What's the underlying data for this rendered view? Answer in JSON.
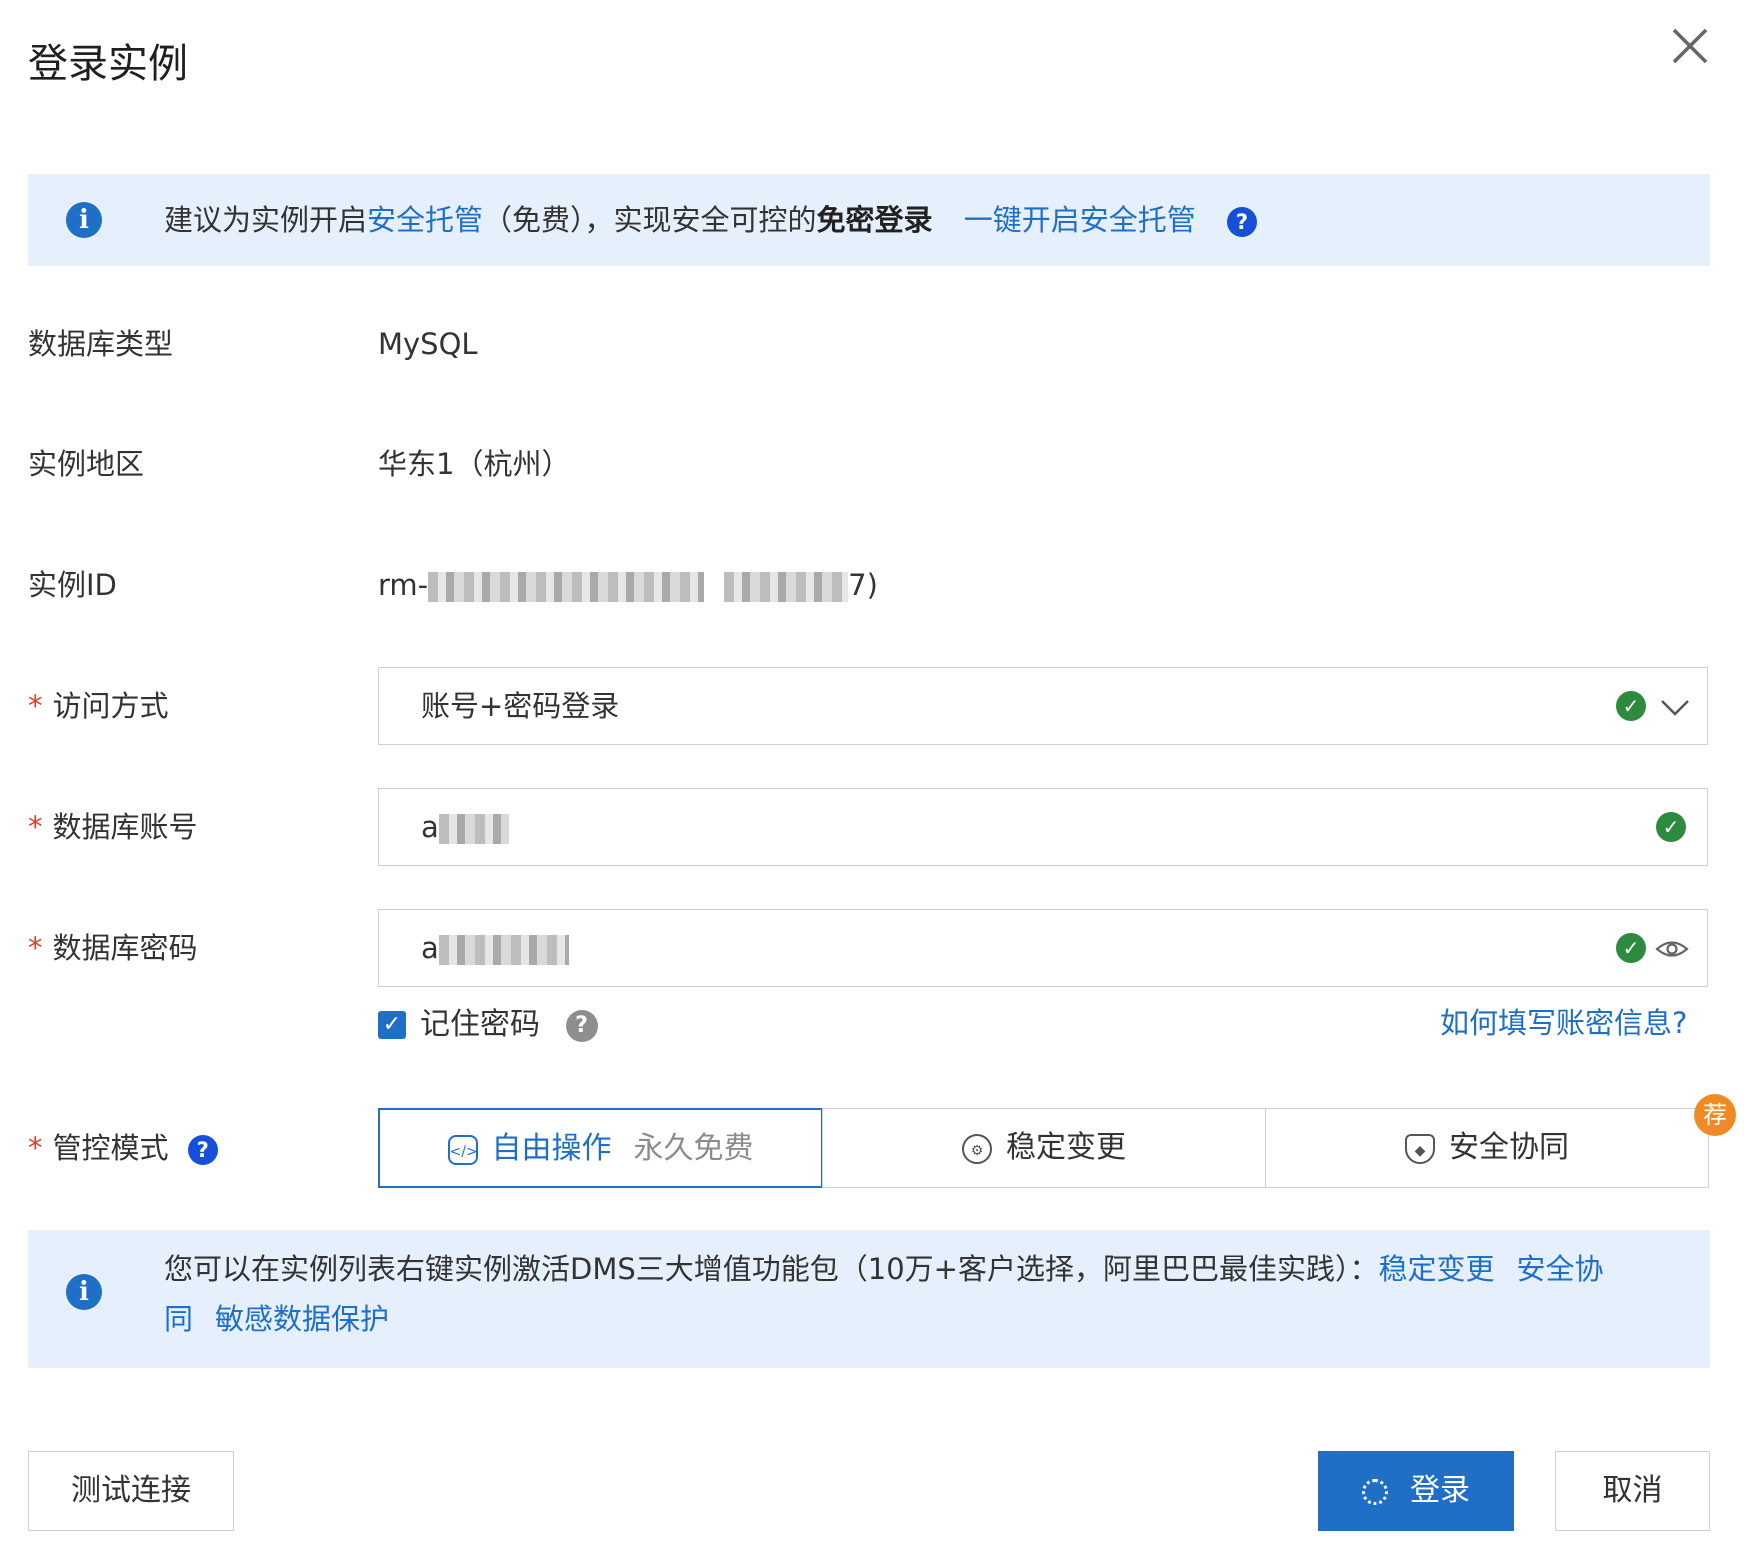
{
  "dialog": {
    "title": "登录实例",
    "close_icon": "close-icon"
  },
  "top_banner": {
    "text_1": "建议为实例开启",
    "link_1": "安全托管",
    "text_2": "（免费），实现安全可控的",
    "bold": "免密登录",
    "link_2": "一键开启安全托管",
    "help": "?"
  },
  "fields": {
    "db_type": {
      "label": "数据库类型",
      "value": "MySQL"
    },
    "region": {
      "label": "实例地区",
      "value": "华东1（杭州）"
    },
    "instance_id": {
      "label": "实例ID",
      "value_prefix": "rm-",
      "value_suffix": "7)"
    },
    "access_method": {
      "label": "访问方式",
      "value": "账号+密码登录"
    },
    "db_account": {
      "label": "数据库账号",
      "value_prefix": "a"
    },
    "db_password": {
      "label": "数据库密码",
      "value_prefix": "a"
    }
  },
  "remember_password": {
    "label": "记住密码",
    "checked": true,
    "help": "?"
  },
  "help_link": "如何填写账密信息?",
  "control_mode": {
    "label": "管控模式",
    "help": "?",
    "options": [
      {
        "label": "自由操作",
        "sub": "永久免费",
        "active": true,
        "icon": "code-icon"
      },
      {
        "label": "稳定变更",
        "active": false,
        "icon": "gear-icon"
      },
      {
        "label": "安全协同",
        "active": false,
        "icon": "shield-icon"
      }
    ],
    "badge": "荐"
  },
  "bottom_banner": {
    "text_1": "您可以在实例列表右键实例激活DMS三大增值功能包（10万+客户选择，阿里巴巴最佳实践）：",
    "link_1": "稳定变更",
    "link_2a": "安全协",
    "link_2b": "同",
    "link_3": "敏感数据保护"
  },
  "buttons": {
    "test": "测试连接",
    "login": "登录",
    "cancel": "取消"
  },
  "colors": {
    "primary": "#1f6fc7",
    "banner_bg": "#e6f0fc",
    "success": "#2d8a3e",
    "required": "#e0402b",
    "badge": "#f08a24"
  }
}
